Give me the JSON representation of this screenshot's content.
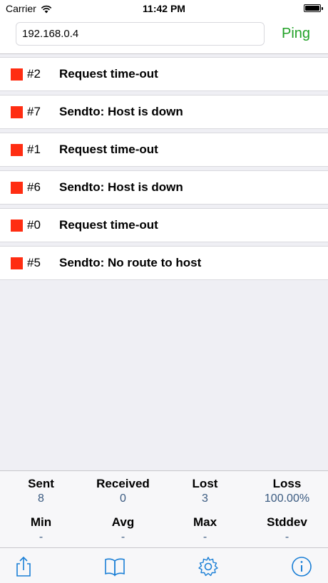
{
  "status_bar": {
    "carrier": "Carrier",
    "time": "11:42 PM"
  },
  "header": {
    "address_value": "192.168.0.4",
    "ping_label": "Ping"
  },
  "results": [
    {
      "seq": "#2",
      "message": "Request time-out"
    },
    {
      "seq": "#7",
      "message": "Sendto: Host is down"
    },
    {
      "seq": "#1",
      "message": "Request time-out"
    },
    {
      "seq": "#6",
      "message": "Sendto: Host is down"
    },
    {
      "seq": "#0",
      "message": "Request time-out"
    },
    {
      "seq": "#5",
      "message": "Sendto: No route to host"
    }
  ],
  "stats": {
    "sent": {
      "label": "Sent",
      "value": "8"
    },
    "received": {
      "label": "Received",
      "value": "0"
    },
    "lost": {
      "label": "Lost",
      "value": "3"
    },
    "loss": {
      "label": "Loss",
      "value": "100.00%"
    },
    "min": {
      "label": "Min",
      "value": "-"
    },
    "avg": {
      "label": "Avg",
      "value": "-"
    },
    "max": {
      "label": "Max",
      "value": "-"
    },
    "stddev": {
      "label": "Stddev",
      "value": "-"
    }
  },
  "tabbar": {
    "icons": [
      "share-icon",
      "book-icon",
      "gear-icon",
      "info-icon"
    ]
  },
  "colors": {
    "ping_green": "#21a127",
    "error_red": "#ff2d12",
    "tint_blue": "#1a7fd6",
    "stat_value": "#3a5a80"
  }
}
